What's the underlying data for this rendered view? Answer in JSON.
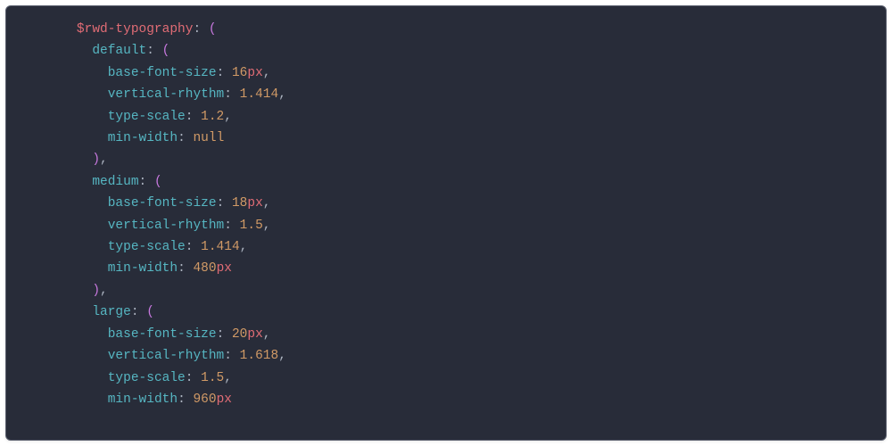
{
  "indent": "       ",
  "step": "  ",
  "code": {
    "variable": "$rwd-typography",
    "colon_open": ": (",
    "close_paren": ")",
    "close_paren_comma": "),",
    "open_brace": " (",
    "blocks": [
      {
        "name": "default",
        "props": [
          {
            "key": "base-font-size",
            "value": "16",
            "unit": "px",
            "trail": ","
          },
          {
            "key": "vertical-rhythm",
            "value": "1.414",
            "unit": "",
            "trail": ","
          },
          {
            "key": "type-scale",
            "value": "1.2",
            "unit": "",
            "trail": ","
          },
          {
            "key": "min-width",
            "value": "null",
            "unit": "",
            "trail": "",
            "is_null": true
          }
        ]
      },
      {
        "name": "medium",
        "props": [
          {
            "key": "base-font-size",
            "value": "18",
            "unit": "px",
            "trail": ","
          },
          {
            "key": "vertical-rhythm",
            "value": "1.5",
            "unit": "",
            "trail": ","
          },
          {
            "key": "type-scale",
            "value": "1.414",
            "unit": "",
            "trail": ","
          },
          {
            "key": "min-width",
            "value": "480",
            "unit": "px",
            "trail": ""
          }
        ]
      },
      {
        "name": "large",
        "props": [
          {
            "key": "base-font-size",
            "value": "20",
            "unit": "px",
            "trail": ","
          },
          {
            "key": "vertical-rhythm",
            "value": "1.618",
            "unit": "",
            "trail": ","
          },
          {
            "key": "type-scale",
            "value": "1.5",
            "unit": "",
            "trail": ","
          },
          {
            "key": "min-width",
            "value": "960",
            "unit": "px",
            "trail": ""
          }
        ]
      }
    ]
  }
}
